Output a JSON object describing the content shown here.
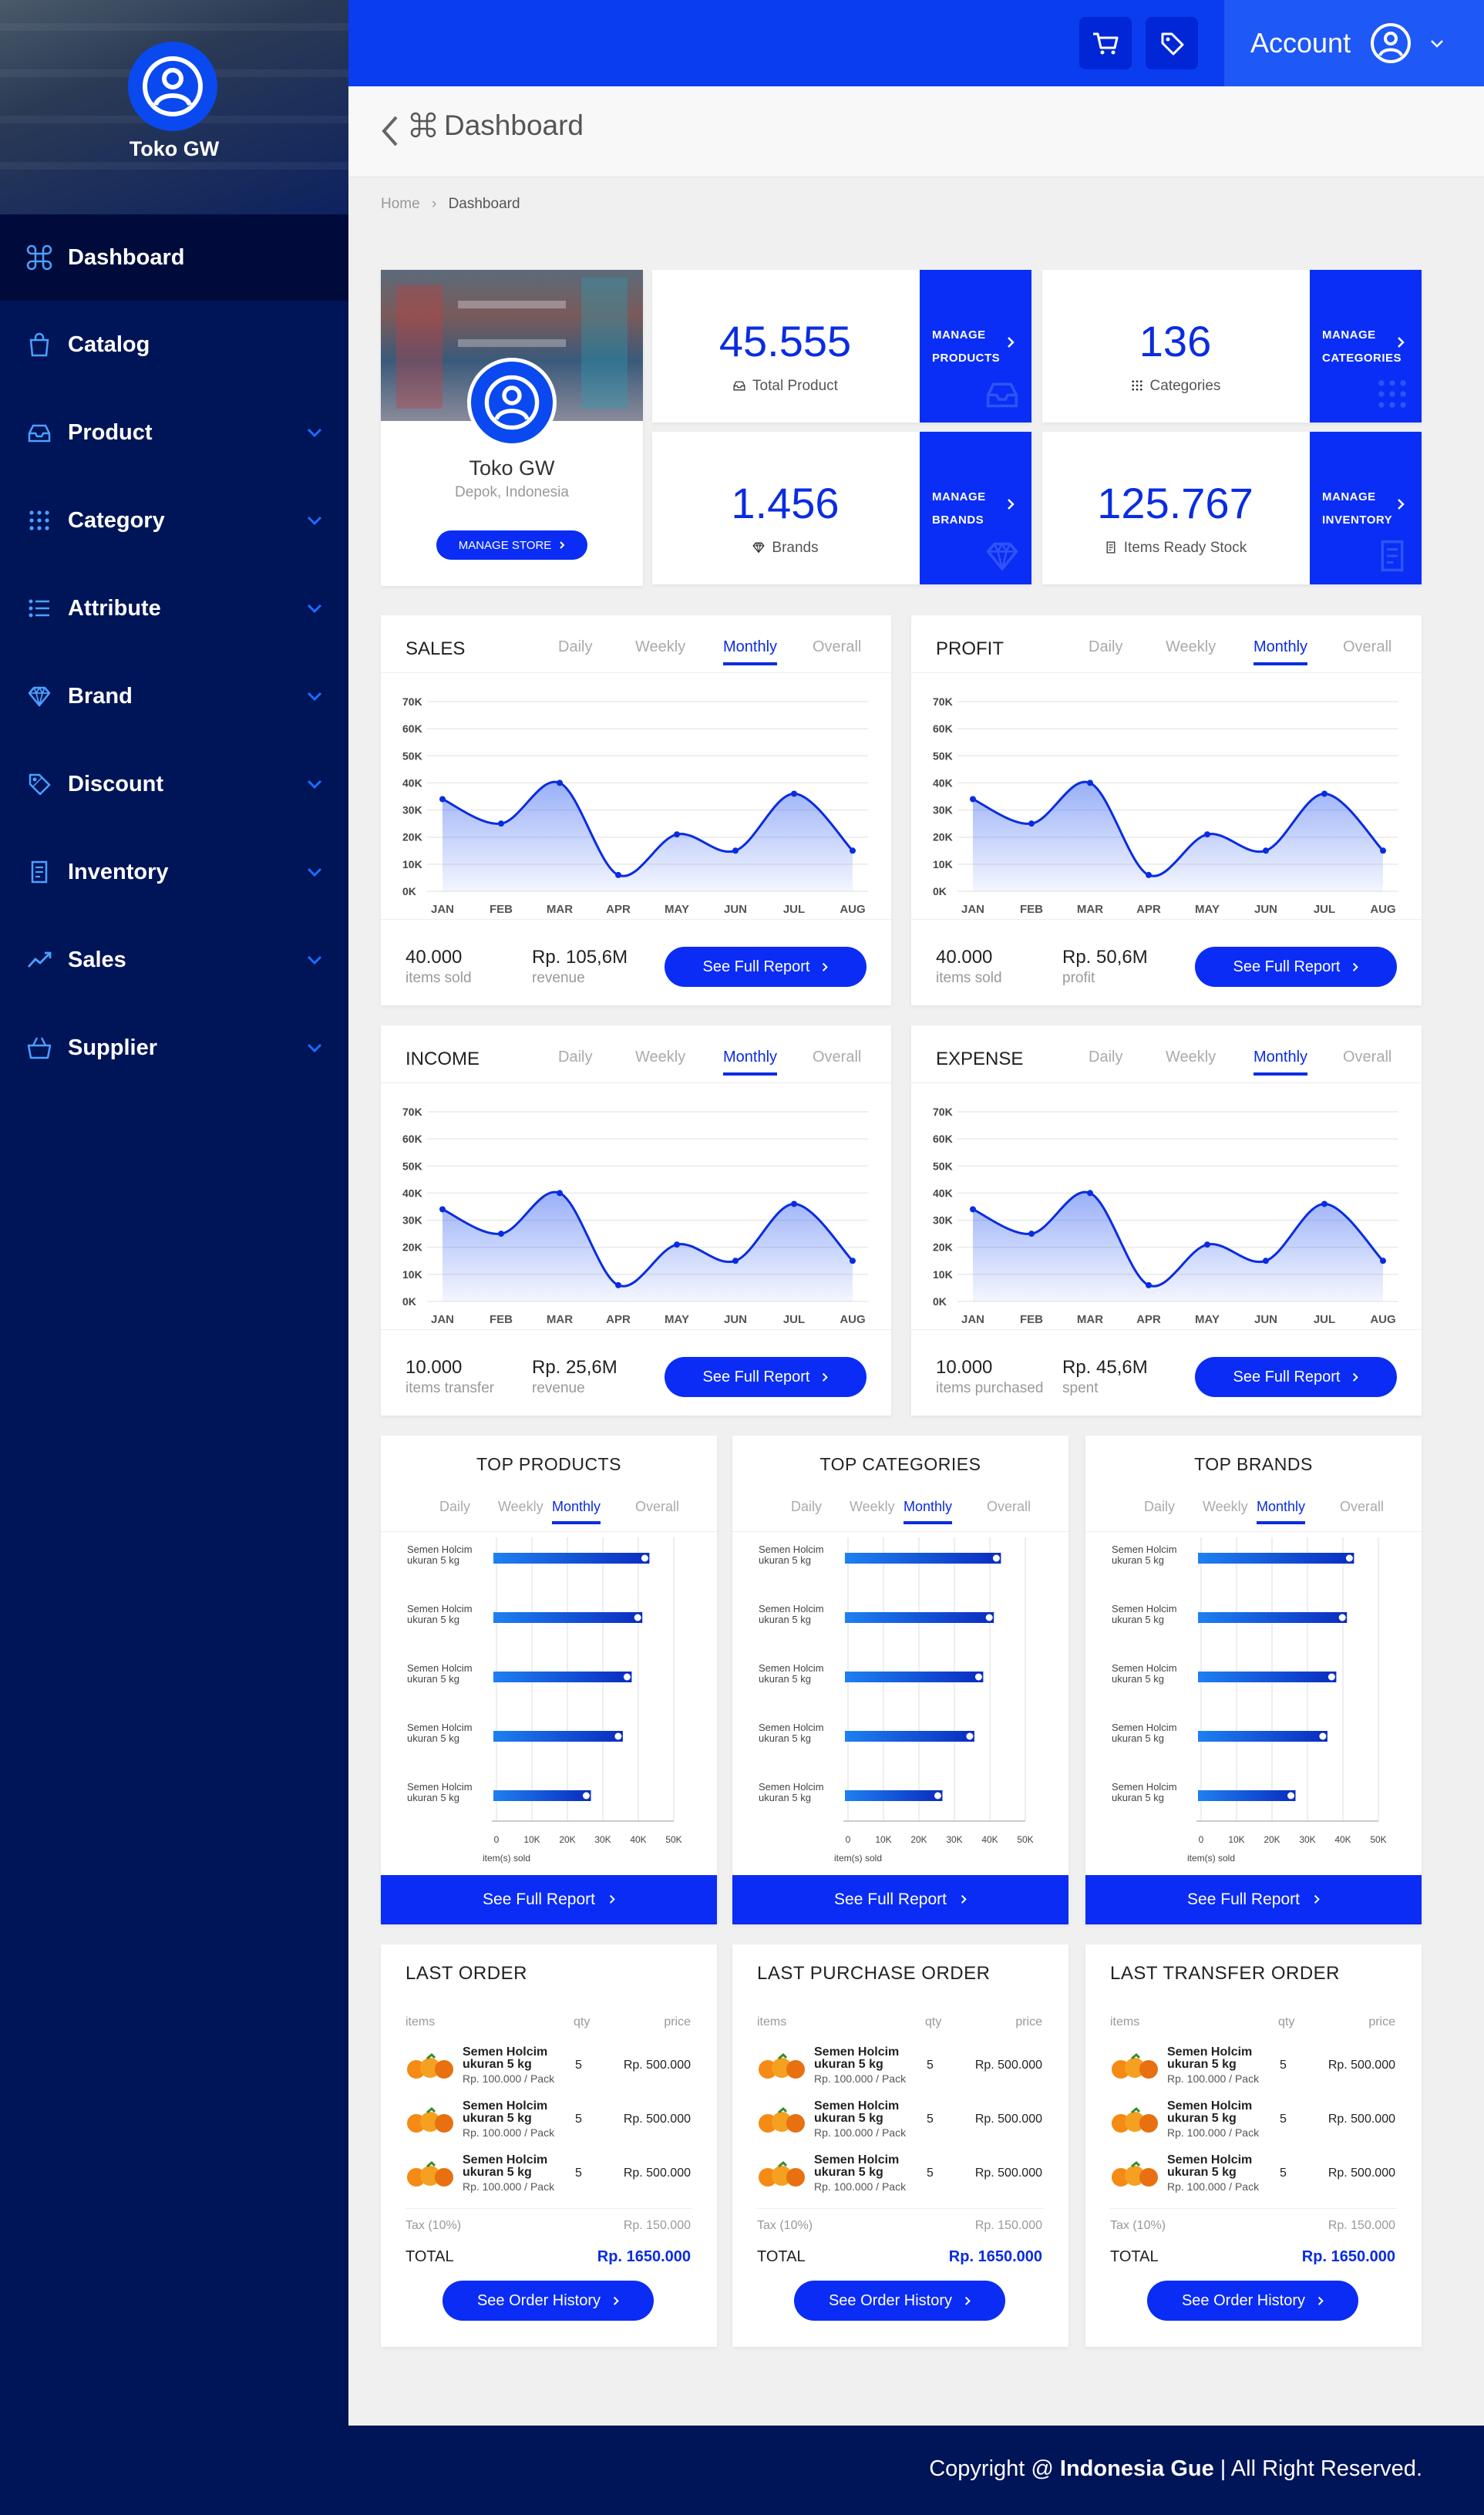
{
  "sidebar": {
    "store_name": "Toko GW",
    "items": [
      {
        "label": "Dashboard",
        "icon": "command-icon",
        "active": true,
        "has_chevron": false
      },
      {
        "label": "Catalog",
        "icon": "shopping-bag-icon",
        "active": false,
        "has_chevron": false
      },
      {
        "label": "Product",
        "icon": "tray-icon",
        "active": false,
        "has_chevron": true
      },
      {
        "label": "Category",
        "icon": "grid-dots-icon",
        "active": false,
        "has_chevron": true
      },
      {
        "label": "Attribute",
        "icon": "list-icon",
        "active": false,
        "has_chevron": true
      },
      {
        "label": "Brand",
        "icon": "diamond-icon",
        "active": false,
        "has_chevron": true
      },
      {
        "label": "Discount",
        "icon": "tag-icon",
        "active": false,
        "has_chevron": true
      },
      {
        "label": "Inventory",
        "icon": "document-icon",
        "active": false,
        "has_chevron": true
      },
      {
        "label": "Sales",
        "icon": "trend-icon",
        "active": false,
        "has_chevron": true
      },
      {
        "label": "Supplier",
        "icon": "basket-icon",
        "active": false,
        "has_chevron": true
      }
    ]
  },
  "topbar": {
    "account_label": "Account"
  },
  "header": {
    "title": "Dashboard",
    "breadcrumb": [
      "Home",
      "Dashboard"
    ]
  },
  "store_card": {
    "name": "Toko GW",
    "location": "Depok, Indonesia",
    "button": "MANAGE STORE"
  },
  "stats": [
    {
      "value": "45.555",
      "label": "Total Product",
      "action_line1": "MANAGE",
      "action_line2": "PRODUCTS",
      "icon": "tray-icon"
    },
    {
      "value": "136",
      "label": "Categories",
      "action_line1": "MANAGE",
      "action_line2": "CATEGORIES",
      "icon": "grid-dots-icon"
    },
    {
      "value": "1.456",
      "label": "Brands",
      "action_line1": "MANAGE",
      "action_line2": "BRANDS",
      "icon": "diamond-icon"
    },
    {
      "value": "125.767",
      "label": "Items Ready Stock",
      "action_line1": "MANAGE",
      "action_line2": "INVENTORY",
      "icon": "document-icon"
    }
  ],
  "period_tabs": [
    "Daily",
    "Weekly",
    "Monthly",
    "Overall"
  ],
  "active_tab": "Monthly",
  "chart_data": [
    {
      "type": "area",
      "title": "SALES",
      "x": [
        "JAN",
        "FEB",
        "MAR",
        "APR",
        "MAY",
        "JUN",
        "JUL",
        "AUG"
      ],
      "y_ticks": [
        "0K",
        "10K",
        "20K",
        "30K",
        "40K",
        "50K",
        "60K",
        "70K"
      ],
      "ylim": [
        0,
        70000
      ],
      "values": [
        34000,
        25000,
        40000,
        6000,
        21000,
        15000,
        36000,
        15000
      ],
      "grid": true,
      "footer_value_1": "40.000",
      "footer_sub_1": "items sold",
      "footer_value_2": "Rp. 105,6M",
      "footer_sub_2": "revenue"
    },
    {
      "type": "area",
      "title": "PROFIT",
      "x": [
        "JAN",
        "FEB",
        "MAR",
        "APR",
        "MAY",
        "JUN",
        "JUL",
        "AUG"
      ],
      "y_ticks": [
        "0K",
        "10K",
        "20K",
        "30K",
        "40K",
        "50K",
        "60K",
        "70K"
      ],
      "ylim": [
        0,
        70000
      ],
      "values": [
        34000,
        25000,
        40000,
        6000,
        21000,
        15000,
        36000,
        15000
      ],
      "grid": true,
      "footer_value_1": "40.000",
      "footer_sub_1": "items sold",
      "footer_value_2": "Rp. 50,6M",
      "footer_sub_2": "profit"
    },
    {
      "type": "area",
      "title": "INCOME",
      "x": [
        "JAN",
        "FEB",
        "MAR",
        "APR",
        "MAY",
        "JUN",
        "JUL",
        "AUG"
      ],
      "y_ticks": [
        "0K",
        "10K",
        "20K",
        "30K",
        "40K",
        "50K",
        "60K",
        "70K"
      ],
      "ylim": [
        0,
        70000
      ],
      "values": [
        34000,
        25000,
        40000,
        6000,
        21000,
        15000,
        36000,
        15000
      ],
      "grid": true,
      "footer_value_1": "10.000",
      "footer_sub_1": "items transfer",
      "footer_value_2": "Rp. 25,6M",
      "footer_sub_2": "revenue"
    },
    {
      "type": "area",
      "title": "EXPENSE",
      "x": [
        "JAN",
        "FEB",
        "MAR",
        "APR",
        "MAY",
        "JUN",
        "JUL",
        "AUG"
      ],
      "y_ticks": [
        "0K",
        "10K",
        "20K",
        "30K",
        "40K",
        "50K",
        "60K",
        "70K"
      ],
      "ylim": [
        0,
        70000
      ],
      "values": [
        34000,
        25000,
        40000,
        6000,
        21000,
        15000,
        36000,
        15000
      ],
      "grid": true,
      "footer_value_1": "10.000",
      "footer_sub_1": "items purchased",
      "footer_value_2": "Rp. 45,6M",
      "footer_sub_2": "spent"
    },
    {
      "type": "bar",
      "orientation": "horizontal",
      "title": "TOP PRODUCTS",
      "categories": [
        "Semen Holcim ukuran 5 kg",
        "Semen Holcim ukuran 5 kg",
        "Semen Holcim ukuran 5 kg",
        "Semen Holcim ukuran 5 kg",
        "Semen Holcim ukuran 5 kg"
      ],
      "values": [
        44000,
        42000,
        39000,
        36500,
        27500
      ],
      "x_ticks": [
        "0",
        "10K",
        "20K",
        "30K",
        "40K",
        "50K"
      ],
      "xlim": [
        0,
        50000
      ],
      "xlabel": "item(s) sold",
      "grid": true
    },
    {
      "type": "bar",
      "orientation": "horizontal",
      "title": "TOP CATEGORIES",
      "categories": [
        "Semen Holcim ukuran 5 kg",
        "Semen Holcim ukuran 5 kg",
        "Semen Holcim ukuran 5 kg",
        "Semen Holcim ukuran 5 kg",
        "Semen Holcim ukuran 5 kg"
      ],
      "values": [
        44000,
        42000,
        39000,
        36500,
        27500
      ],
      "x_ticks": [
        "0",
        "10K",
        "20K",
        "30K",
        "40K",
        "50K"
      ],
      "xlim": [
        0,
        50000
      ],
      "xlabel": "item(s) sold",
      "grid": true
    },
    {
      "type": "bar",
      "orientation": "horizontal",
      "title": "TOP BRANDS",
      "categories": [
        "Semen Holcim ukuran 5 kg",
        "Semen Holcim ukuran 5 kg",
        "Semen Holcim ukuran 5 kg",
        "Semen Holcim ukuran 5 kg",
        "Semen Holcim ukuran 5 kg"
      ],
      "values": [
        44000,
        42000,
        39000,
        36500,
        27500
      ],
      "x_ticks": [
        "0",
        "10K",
        "20K",
        "30K",
        "40K",
        "50K"
      ],
      "xlim": [
        0,
        50000
      ],
      "xlabel": "item(s) sold",
      "grid": true
    }
  ],
  "full_report_label": "See Full Report",
  "orders": [
    {
      "title": "LAST ORDER",
      "rows": [
        {
          "name1": "Semen Holcim",
          "name2": "ukuran 5 kg",
          "unit": "Rp. 100.000 / Pack",
          "qty": "5",
          "price": "Rp. 500.000"
        },
        {
          "name1": "Semen Holcim",
          "name2": "ukuran 5 kg",
          "unit": "Rp. 100.000 / Pack",
          "qty": "5",
          "price": "Rp. 500.000"
        },
        {
          "name1": "Semen Holcim",
          "name2": "ukuran 5 kg",
          "unit": "Rp. 100.000 / Pack",
          "qty": "5",
          "price": "Rp. 500.000"
        }
      ],
      "tax": "Rp. 150.000",
      "total": "Rp. 1650.000"
    },
    {
      "title": "LAST PURCHASE ORDER",
      "rows": [
        {
          "name1": "Semen Holcim",
          "name2": "ukuran 5 kg",
          "unit": "Rp. 100.000 / Pack",
          "qty": "5",
          "price": "Rp. 500.000"
        },
        {
          "name1": "Semen Holcim",
          "name2": "ukuran 5 kg",
          "unit": "Rp. 100.000 / Pack",
          "qty": "5",
          "price": "Rp. 500.000"
        },
        {
          "name1": "Semen Holcim",
          "name2": "ukuran 5 kg",
          "unit": "Rp. 100.000 / Pack",
          "qty": "5",
          "price": "Rp. 500.000"
        }
      ],
      "tax": "Rp. 150.000",
      "total": "Rp. 1650.000"
    },
    {
      "title": "LAST TRANSFER ORDER",
      "rows": [
        {
          "name1": "Semen Holcim",
          "name2": "ukuran 5 kg",
          "unit": "Rp. 100.000 / Pack",
          "qty": "5",
          "price": "Rp. 500.000"
        },
        {
          "name1": "Semen Holcim",
          "name2": "ukuran 5 kg",
          "unit": "Rp. 100.000 / Pack",
          "qty": "5",
          "price": "Rp. 500.000"
        },
        {
          "name1": "Semen Holcim",
          "name2": "ukuran 5 kg",
          "unit": "Rp. 100.000 / Pack",
          "qty": "5",
          "price": "Rp. 500.000"
        }
      ],
      "tax": "Rp. 150.000",
      "total": "Rp. 1650.000"
    }
  ],
  "order_labels": {
    "items": "items",
    "qty": "qty",
    "price": "price",
    "tax": "Tax (10%)",
    "total": "TOTAL",
    "history_button": "See Order History"
  },
  "footer": {
    "prefix": "Copyright @ ",
    "brand": "Indonesia Gue",
    "suffix": " | All Right Reserved."
  },
  "colors": {
    "primary": "#0a2cf5",
    "sidebar": "#001458",
    "topbar": "#0a3cf0",
    "accent_text": "#0a2ce0"
  }
}
